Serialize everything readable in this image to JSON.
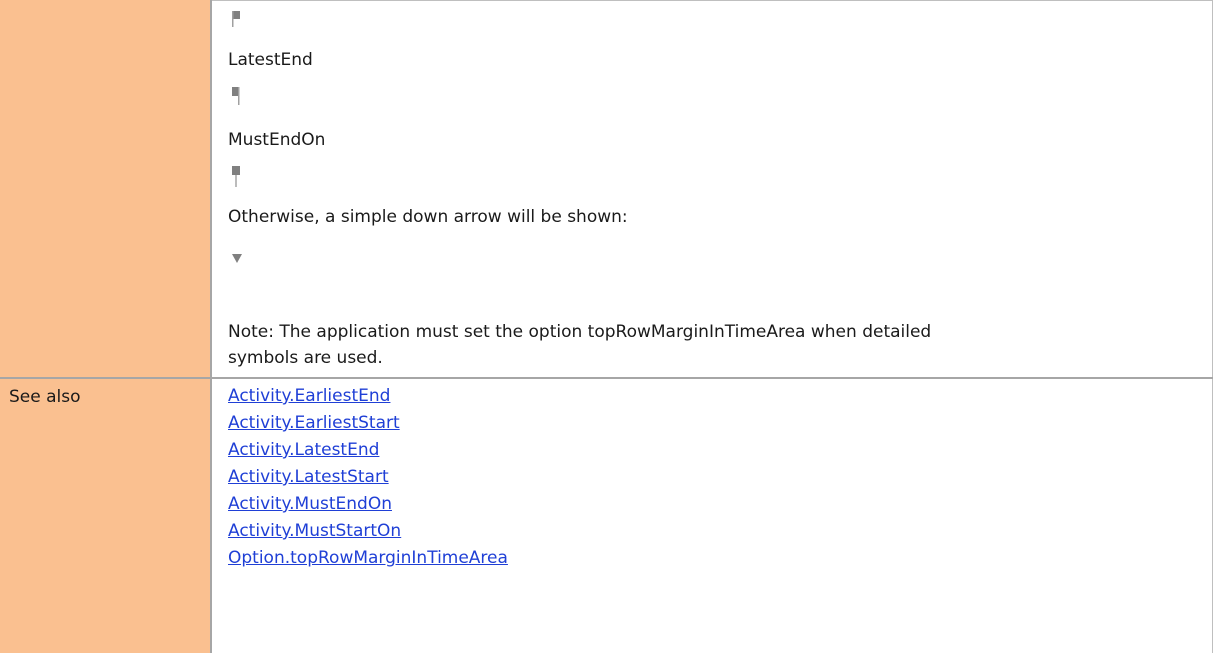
{
  "top_row": {
    "label": "",
    "items": [
      {
        "type": "symbol",
        "icon": "flag-icon"
      },
      {
        "type": "text",
        "text": "LatestEnd"
      },
      {
        "type": "symbol",
        "icon": "latest-end-flag-icon"
      },
      {
        "type": "text",
        "text": "MustEndOn"
      },
      {
        "type": "symbol",
        "icon": "must-end-on-pin-icon"
      },
      {
        "type": "text",
        "text": "Otherwise, a simple down arrow will be shown:"
      },
      {
        "type": "symbol",
        "icon": "down-arrow-icon"
      }
    ],
    "note_line1": "Note: The application must set the option topRowMarginInTimeArea when detailed",
    "note_line2": "symbols are used."
  },
  "see_also": {
    "label": "See also",
    "links": [
      "Activity.EarliestEnd",
      "Activity.EarliestStart",
      "Activity.LatestEnd",
      "Activity.LatestStart",
      "Activity.MustEndOn",
      "Activity.MustStartOn",
      "Option.topRowMarginInTimeArea"
    ]
  },
  "colors": {
    "label_cell_bg": "#fac090",
    "link": "#1f3fd6",
    "symbol": "#808080",
    "border": "#a6a6a6"
  }
}
